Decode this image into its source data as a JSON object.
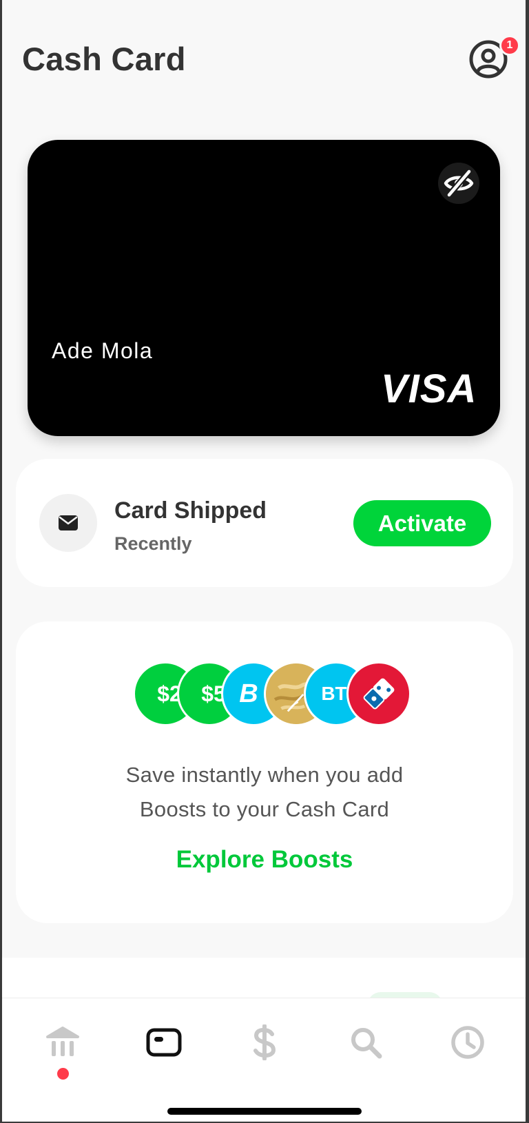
{
  "header": {
    "title": "Cash Card",
    "profile_badge_count": "1",
    "profile_icon": "user-circle-icon"
  },
  "card": {
    "holder_name": "Ade Mola",
    "network": "VISA",
    "visibility_icon": "eye-off-icon",
    "color": "#000000"
  },
  "shipping": {
    "icon": "envelope-icon",
    "title": "Card Shipped",
    "subtitle": "Recently",
    "action_label": "Activate",
    "action_color": "#00d43a"
  },
  "boosts": {
    "bubbles": [
      {
        "label": "$2",
        "color": "#00cf3e"
      },
      {
        "label": "$5",
        "color": "#00cf3e"
      },
      {
        "label": "B",
        "color": "#00c5f0",
        "icon": "bitcoin-icon"
      },
      {
        "label": "",
        "color": "#d9b560",
        "icon": "food-photo"
      },
      {
        "label": "BT",
        "color": "#00c5f0"
      },
      {
        "label": "",
        "color": "#e31837",
        "icon": "dominos-logo"
      }
    ],
    "description_line1": "Save instantly when you add",
    "description_line2": "Boosts to your Cash Card",
    "cta": "Explore Boosts",
    "accent": "#00c83a"
  },
  "tabbar": {
    "tabs": [
      {
        "name": "banking",
        "icon": "bank-icon"
      },
      {
        "name": "cash-card",
        "icon": "card-icon",
        "active": true
      },
      {
        "name": "cash",
        "icon": "dollar-icon"
      },
      {
        "name": "discover",
        "icon": "search-icon"
      },
      {
        "name": "activity",
        "icon": "clock-icon"
      }
    ],
    "notification_on": "banking"
  }
}
